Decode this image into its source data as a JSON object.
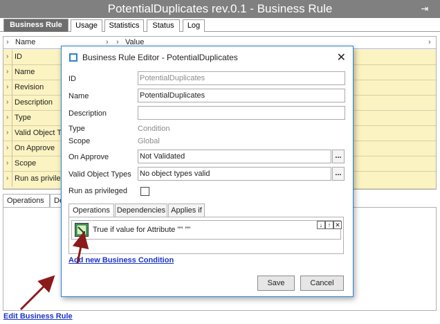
{
  "window": {
    "title": "PotentialDuplicates rev.0.1 - Business Rule"
  },
  "main_tabs": [
    "Business Rule",
    "Usage",
    "Statistics",
    "Status",
    "Log"
  ],
  "grid": {
    "headers": [
      "Name",
      "Value"
    ],
    "rows": [
      "ID",
      "Name",
      "Revision",
      "Description",
      "Type",
      "Valid Object T",
      "On Approve",
      "Scope",
      "Run as privileged"
    ]
  },
  "lower_tabs": [
    "Operations",
    "De"
  ],
  "edit_link": "Edit Business Rule",
  "dialog": {
    "title": "Business Rule Editor - PotentialDuplicates",
    "fields": {
      "id_label": "ID",
      "id_value": "PotentialDuplicates",
      "name_label": "Name",
      "name_value": "PotentialDuplicates",
      "description_label": "Description",
      "description_value": "",
      "type_label": "Type",
      "type_value": "Condition",
      "scope_label": "Scope",
      "scope_value": "Global",
      "on_approve_label": "On Approve",
      "on_approve_value": "Not Validated",
      "valid_types_label": "Valid Object Types",
      "valid_types_value": "No object types valid",
      "privileged_label": "Run as privileged",
      "ellipsis": "..."
    },
    "tabs": [
      "Operations",
      "Dependencies",
      "Applies if"
    ],
    "condition_text": "True if value for Attribute \"\" \"\"",
    "add_condition": "Add new Business Condition",
    "save": "Save",
    "cancel": "Cancel"
  },
  "colors": {
    "title_bar": "#808080",
    "row_bg": "#fbf3c1",
    "link": "#1a35c8",
    "accent": "#2a7fd8",
    "arrow": "#8b1a1a"
  }
}
